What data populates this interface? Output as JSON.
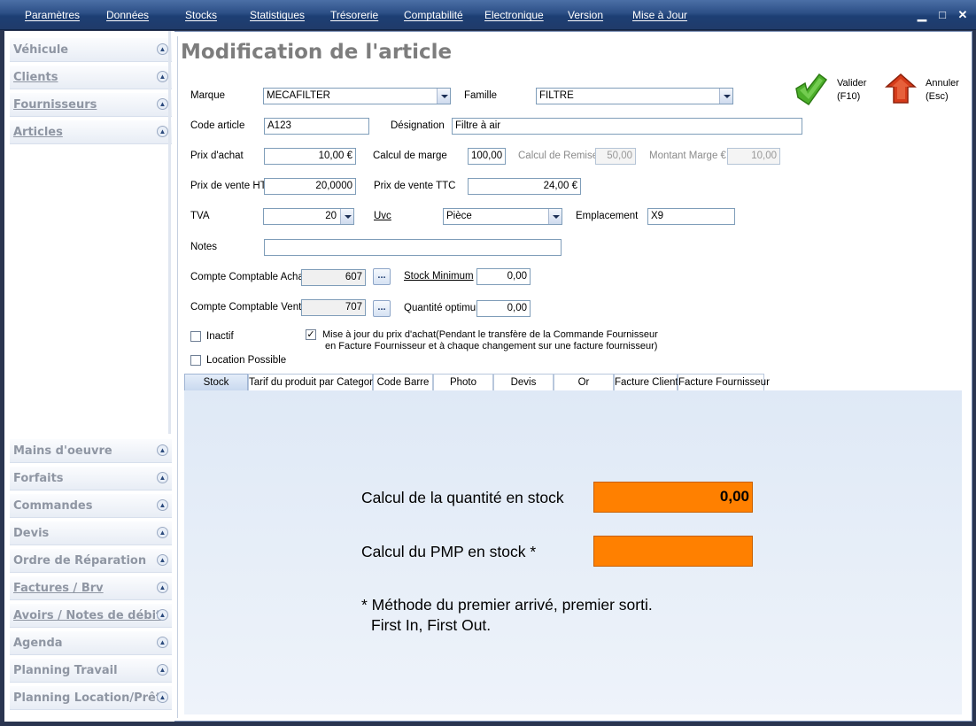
{
  "menu": [
    "Paramètres",
    "Données",
    "Stocks",
    "Statistiques",
    "Trésorerie",
    "Comptabilité",
    "Electronique",
    "Version",
    "Mise à Jour"
  ],
  "window_controls": {
    "minimize": "▁",
    "maximize": "□",
    "close": "✕"
  },
  "sidebar_top": [
    "Véhicule",
    "Clients",
    "Fournisseurs",
    "Articles"
  ],
  "sidebar_bottom": [
    "Mains d'oeuvre",
    "Forfaits",
    "Commandes",
    "Devis",
    "Ordre de Réparation",
    "Factures / Brv",
    "Avoirs / Notes de débit",
    "Agenda",
    "Planning Travail",
    "Planning Location/Prêt"
  ],
  "page_title": "Modification de l'article",
  "actions": {
    "validate_label": "Valider",
    "validate_key": "(F10)",
    "cancel_label": "Annuler",
    "cancel_key": "(Esc)"
  },
  "form": {
    "marque_label": "Marque",
    "marque_value": "MECAFILTER",
    "famille_label": "Famille",
    "famille_value": "FILTRE",
    "code_label": "Code article",
    "code_value": "A123",
    "designation_label": "Désignation",
    "designation_value": "Filtre à air",
    "prix_achat_label": "Prix d'achat",
    "prix_achat_value": "10,00 €",
    "calcul_marge_label": "Calcul de marge",
    "calcul_marge_value": "100,00",
    "calcul_remise_label": "Calcul de Remise",
    "calcul_remise_value": "50,00",
    "montant_marge_label": "Montant Marge €",
    "montant_marge_value": "10,00",
    "prix_vente_ht_label": "Prix de vente HT",
    "prix_vente_ht_value": "20,0000",
    "prix_vente_ttc_label": "Prix de vente TTC",
    "prix_vente_ttc_value": "24,00 €",
    "tva_label": "TVA",
    "tva_value": "20",
    "uvc_label": "Uvc",
    "uvc_value": "Pièce",
    "emplacement_label": "Emplacement",
    "emplacement_value": "X9",
    "notes_label": "Notes",
    "notes_value": "",
    "cc_achat_label": "Compte Comptable Achat",
    "cc_achat_value": "607",
    "cc_vente_label": "Compte Comptable Vente",
    "cc_vente_value": "707",
    "dots_label": "...",
    "stock_min_label": "Stock Minimum",
    "stock_min_value": "0,00",
    "qte_opt_label": "Quantité optimum",
    "qte_opt_value": "0,00",
    "inactif_label": "Inactif",
    "location_label": "Location Possible",
    "maj_label_line1": "Mise à jour du prix d'achat(Pendant le transfère de la Commande Fournisseur",
    "maj_label_line2": "en Facture Fournisseur et à chaque changement sur une facture fournisseur)",
    "check_mark": "✓"
  },
  "tabs": [
    "Stock",
    "Tarif du produit par Categorie",
    "Code Barre",
    "Photo",
    "Devis",
    "Or",
    "Facture Client",
    "Facture Fournisseur"
  ],
  "stock_panel": {
    "qty_label": "Calcul de la quantité en stock",
    "qty_value": "0,00",
    "pmp_label": "Calcul du PMP en stock *",
    "pmp_value": "",
    "note_line1": "* Méthode du premier arrivé, premier sorti.",
    "note_line2": "First In, First Out."
  },
  "colors": {
    "accent_orange": "#ff8000",
    "menubar": "#2c4f86",
    "validate_green": "#4caf2a",
    "cancel_red": "#d63b1a"
  }
}
